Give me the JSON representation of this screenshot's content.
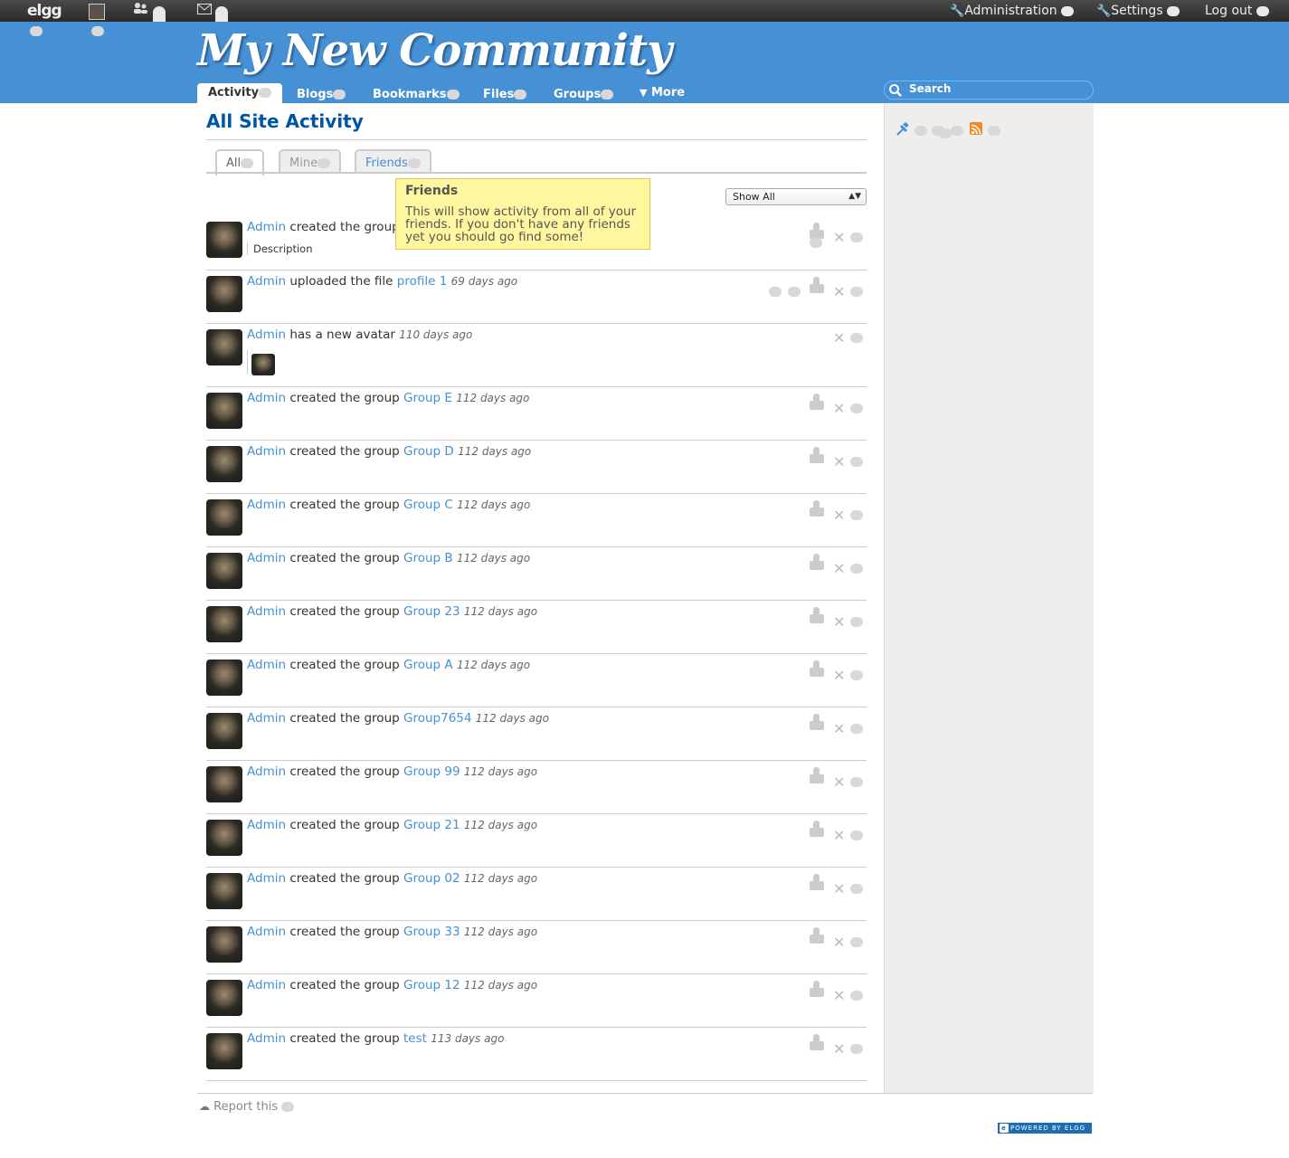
{
  "topbar": {
    "logo": "elgg",
    "admin_label": "Administration",
    "settings_label": "Settings",
    "logout_label": "Log out"
  },
  "header": {
    "site_title": "My New Community",
    "nav": [
      {
        "label": "Activity",
        "active": true
      },
      {
        "label": "Blogs"
      },
      {
        "label": "Bookmarks"
      },
      {
        "label": "Files"
      },
      {
        "label": "Groups"
      },
      {
        "label": "More",
        "icon": "caret-down-icon"
      }
    ],
    "search_placeholder": "Search"
  },
  "main": {
    "title": "All Site Activity",
    "filter_tabs": [
      {
        "label": "All",
        "active": true
      },
      {
        "label": "Mine"
      },
      {
        "label": "Friends"
      }
    ],
    "tooltip": {
      "title": "Friends",
      "body": "This will show activity from all of your friends. If you don't have any friends yet you should go find some!"
    },
    "type_filter": "Show All",
    "items": [
      {
        "actor": "Admin",
        "verb": "created the group",
        "object": "",
        "time": "",
        "description": "Description"
      },
      {
        "actor": "Admin",
        "verb": "uploaded the file",
        "object": "profile 1",
        "time": "69 days ago"
      },
      {
        "actor": "Admin",
        "verb": "has a new avatar",
        "object": "",
        "time": "110 days ago"
      },
      {
        "actor": "Admin",
        "verb": "created the group",
        "object": "Group E",
        "time": "112 days ago"
      },
      {
        "actor": "Admin",
        "verb": "created the group",
        "object": "Group D",
        "time": "112 days ago"
      },
      {
        "actor": "Admin",
        "verb": "created the group",
        "object": "Group C",
        "time": "112 days ago"
      },
      {
        "actor": "Admin",
        "verb": "created the group",
        "object": "Group B",
        "time": "112 days ago"
      },
      {
        "actor": "Admin",
        "verb": "created the group",
        "object": "Group 23",
        "time": "112 days ago"
      },
      {
        "actor": "Admin",
        "verb": "created the group",
        "object": "Group A",
        "time": "112 days ago"
      },
      {
        "actor": "Admin",
        "verb": "created the group",
        "object": "Group7654",
        "time": "112 days ago"
      },
      {
        "actor": "Admin",
        "verb": "created the group",
        "object": "Group 99",
        "time": "112 days ago"
      },
      {
        "actor": "Admin",
        "verb": "created the group",
        "object": "Group 21",
        "time": "112 days ago"
      },
      {
        "actor": "Admin",
        "verb": "created the group",
        "object": "Group 02",
        "time": "112 days ago"
      },
      {
        "actor": "Admin",
        "verb": "created the group",
        "object": "Group 33",
        "time": "112 days ago"
      },
      {
        "actor": "Admin",
        "verb": "created the group",
        "object": "Group 12",
        "time": "112 days ago"
      },
      {
        "actor": "Admin",
        "verb": "created the group",
        "object": "test",
        "time": "113 days ago"
      }
    ]
  },
  "footer": {
    "report_label": "Report this",
    "powered_by": "POWERED BY ELGG"
  }
}
